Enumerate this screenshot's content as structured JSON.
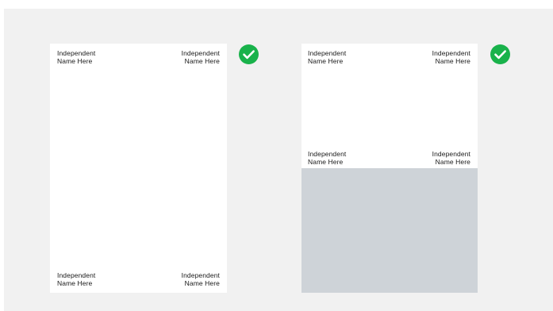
{
  "colors": {
    "background": "#f1f1f1",
    "panel": "#ffffff",
    "gray_block": "#ced3d8",
    "check": "#19b24b"
  },
  "icons": {
    "check": "check-circle-icon"
  },
  "left_panel": {
    "top_left": "Independent\nName Here",
    "top_right": "Independent\nName Here",
    "bottom_left": "Independent\nName Here",
    "bottom_right": "Independent\nName Here"
  },
  "right_panel": {
    "top_left": "Independent\nName Here",
    "top_right": "Independent\nName Here",
    "mid_left": "Independent\nName Here",
    "mid_right": "Independent\nName Here"
  }
}
